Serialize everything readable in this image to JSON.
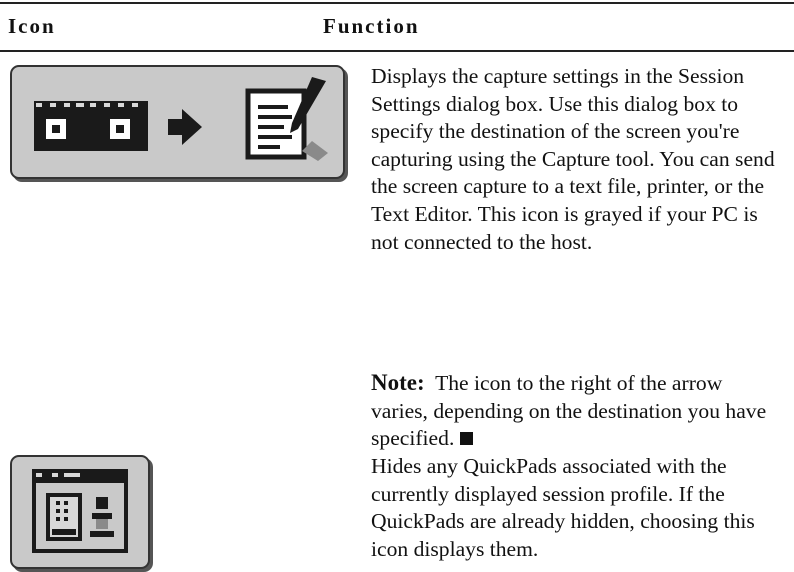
{
  "table": {
    "header": {
      "icon_col": "Icon",
      "function_col": "Function"
    },
    "rows": [
      {
        "icon": "capture-settings-icon",
        "description": "Displays the capture settings in the Session Settings dialog box. Use this dialog box to specify the destination of the screen you're capturing using the Capture tool. You can send the screen capture to a text file, printer, or the Text Editor. This icon is grayed if your PC is not connected to the host.",
        "note_label": "Note:",
        "note_text": "The icon to the right of the arrow varies, depending on the destination you have specified."
      },
      {
        "icon": "quickpads-toggle-icon",
        "description": "Hides any QuickPads associated with the currently displayed session profile. If the QuickPads are already hidden, choosing this icon displays them."
      }
    ]
  }
}
